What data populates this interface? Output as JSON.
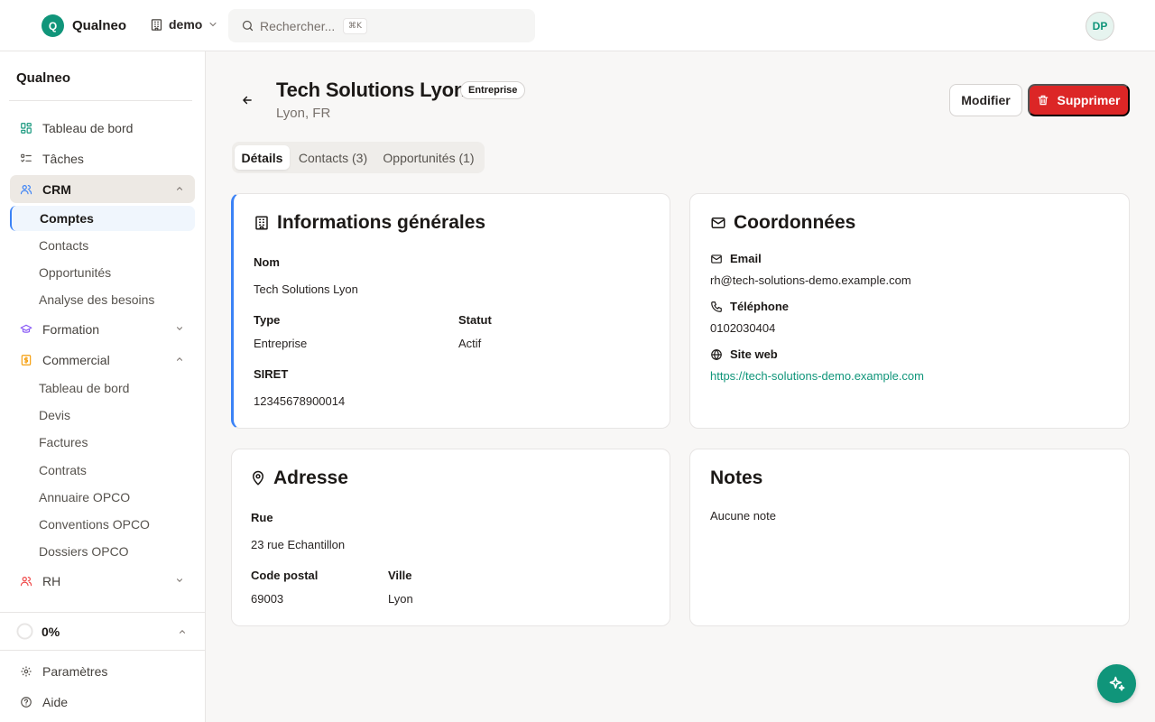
{
  "app": {
    "logo_letter": "Q",
    "name": "Qualneo"
  },
  "workspace": {
    "name": "demo"
  },
  "search": {
    "placeholder": "Rechercher...",
    "shortcut": "⌘K"
  },
  "user": {
    "initials": "DP"
  },
  "sidebar": {
    "title": "Qualneo",
    "items": [
      {
        "label": "Tableau de bord",
        "icon": "dashboard-icon"
      },
      {
        "label": "Tâches",
        "icon": "tasks-icon"
      },
      {
        "label": "CRM",
        "icon": "users-icon",
        "expanded": true,
        "children": [
          "Comptes",
          "Contacts",
          "Opportunités",
          "Analyse des besoins"
        ],
        "active_child": "Comptes"
      },
      {
        "label": "Formation",
        "icon": "graduation-cap-icon",
        "expanded": false
      },
      {
        "label": "Commercial",
        "icon": "dollar-icon",
        "expanded": true,
        "children": [
          "Tableau de bord",
          "Devis",
          "Factures",
          "Contrats",
          "Annuaire OPCO",
          "Conventions OPCO",
          "Dossiers OPCO"
        ]
      },
      {
        "label": "RH",
        "icon": "users-icon",
        "expanded": false
      }
    ],
    "progress": "0%",
    "footer": [
      {
        "label": "Paramètres",
        "icon": "gear-icon"
      },
      {
        "label": "Aide",
        "icon": "help-icon"
      }
    ]
  },
  "account": {
    "name": "Tech Solutions Lyon",
    "badge": "Entreprise",
    "location": "Lyon, FR"
  },
  "actions": {
    "edit": "Modifier",
    "delete": "Supprimer"
  },
  "tabs": [
    {
      "label": "Détails",
      "active": true
    },
    {
      "label": "Contacts (3)",
      "active": false
    },
    {
      "label": "Opportunités (1)",
      "active": false
    }
  ],
  "general": {
    "title": "Informations générales",
    "nom_label": "Nom",
    "nom": "Tech Solutions Lyon",
    "type_label": "Type",
    "type": "Entreprise",
    "statut_label": "Statut",
    "statut": "Actif",
    "siret_label": "SIRET",
    "siret": "12345678900014"
  },
  "contact": {
    "title": "Coordonnées",
    "email_label": "Email",
    "email": "rh@tech-solutions-demo.example.com",
    "phone_label": "Téléphone",
    "phone": "0102030404",
    "web_label": "Site web",
    "web": "https://tech-solutions-demo.example.com"
  },
  "address": {
    "title": "Adresse",
    "rue_label": "Rue",
    "rue": "23 rue Echantillon",
    "cp_label": "Code postal",
    "cp": "69003",
    "ville_label": "Ville",
    "ville": "Lyon"
  },
  "notes": {
    "title": "Notes",
    "content": "Aucune note"
  },
  "colors": {
    "brand": "#10957a",
    "danger": "#dc2626",
    "accent": "#3b82f6"
  }
}
